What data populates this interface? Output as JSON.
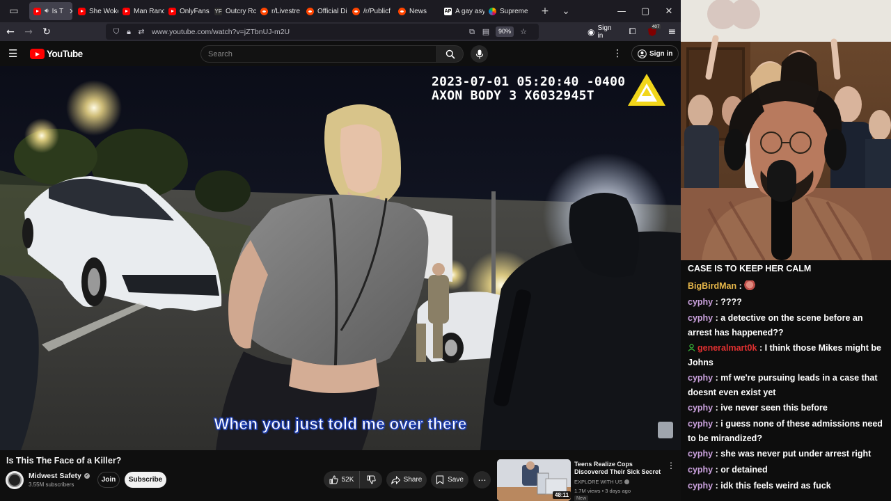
{
  "browser": {
    "tabs": [
      {
        "label": "Is T",
        "favicon": "youtube",
        "active": true
      },
      {
        "label": "She Woke",
        "favicon": "youtube"
      },
      {
        "label": "Man Ranc",
        "favicon": "youtube"
      },
      {
        "label": "OnlyFans",
        "favicon": "youtube"
      },
      {
        "label": "Outcry Rc",
        "favicon": "yahoo-finance"
      },
      {
        "label": "r/Livestre",
        "favicon": "reddit"
      },
      {
        "label": "Official Di",
        "favicon": "reddit"
      },
      {
        "label": "/r/Publicf",
        "favicon": "reddit"
      },
      {
        "label": "News",
        "favicon": "reddit"
      },
      {
        "label": "A gay asy",
        "favicon": "ap"
      },
      {
        "label": "Supreme",
        "favicon": "nbc"
      }
    ],
    "url": "www.youtube.com/watch?v=jZTbnUJ-m2U",
    "zoom": "90%",
    "signin_label": "Sign in",
    "extension_count": "407"
  },
  "youtube": {
    "logo_text": "YouTube",
    "search_placeholder": "Search",
    "signin_label": "Sign in"
  },
  "video": {
    "timestamp_line1": "2023-07-01 05:20:40 -0400",
    "timestamp_line2": "AXON BODY 3 X6032945T",
    "subtitle": "When you just told me over there",
    "title": "Is This The Face of a Killer?"
  },
  "channel": {
    "name": "Midwest Safety",
    "subscribers": "3.55M subscribers",
    "join_label": "Join",
    "subscribe_label": "Subscribe"
  },
  "actions": {
    "likes": "52K",
    "share_label": "Share",
    "save_label": "Save"
  },
  "recommended": {
    "title": "Teens Realize Cops Discovered Their Sick Secret",
    "channel": "EXPLORE WITH US",
    "meta": "1.7M views • 3 days ago",
    "badge": "New",
    "duration": "48:11"
  },
  "chat": {
    "header": "CASE IS TO KEEP HER CALM",
    "messages": [
      {
        "user": "BigBirdMan",
        "text": "",
        "color": "#e8b84a",
        "emote": true
      },
      {
        "user": "cyphy",
        "text": "????",
        "color": "#c9a0dc"
      },
      {
        "user": "cyphy",
        "text": "a detective on the scene before an arrest has happened??",
        "color": "#c9a0dc"
      },
      {
        "user": "generalmart0k",
        "text": "I think those Mikes might be Johns",
        "color": "#e03030",
        "mod": true
      },
      {
        "user": "cyphy",
        "text": "mf we're pursuing leads in a case that doesnt even exist yet",
        "color": "#c9a0dc"
      },
      {
        "user": "cyphy",
        "text": "ive never seen this before",
        "color": "#c9a0dc"
      },
      {
        "user": "cyphy",
        "text": "i guess none of these admissions need to be mirandized?",
        "color": "#c9a0dc"
      },
      {
        "user": "cyphy",
        "text": "she was never put under arrest right",
        "color": "#c9a0dc"
      },
      {
        "user": "cyphy",
        "text": "or detained",
        "color": "#c9a0dc"
      },
      {
        "user": "cyphy",
        "text": "idk this feels weird as fuck",
        "color": "#c9a0dc"
      }
    ]
  }
}
